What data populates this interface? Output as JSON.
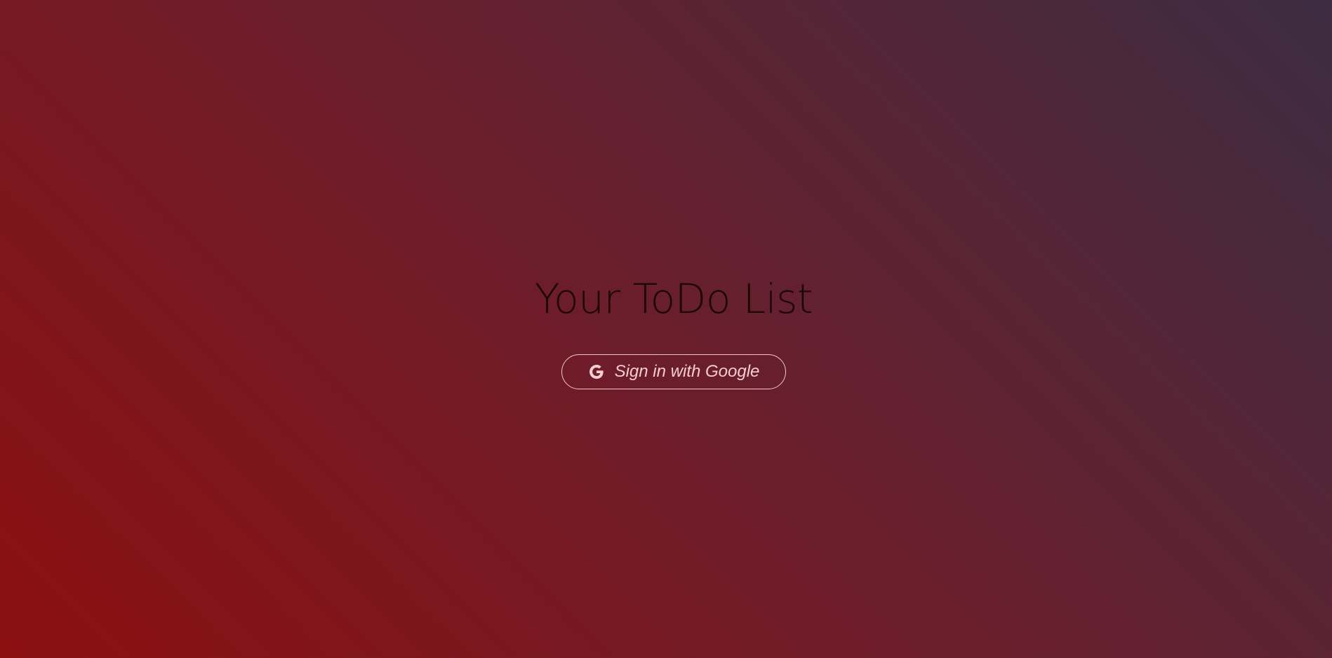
{
  "app": {
    "title": "Your ToDo List"
  },
  "signin": {
    "label": "Sign in with Google",
    "icon": "google-g-icon"
  },
  "colors": {
    "background_start": "#8c1010",
    "background_mid": "#6a1e2c",
    "background_end": "#3d2d42",
    "title_text": "#1c0606",
    "button_border": "#f0c6c9",
    "button_text": "#f6cdd0"
  }
}
